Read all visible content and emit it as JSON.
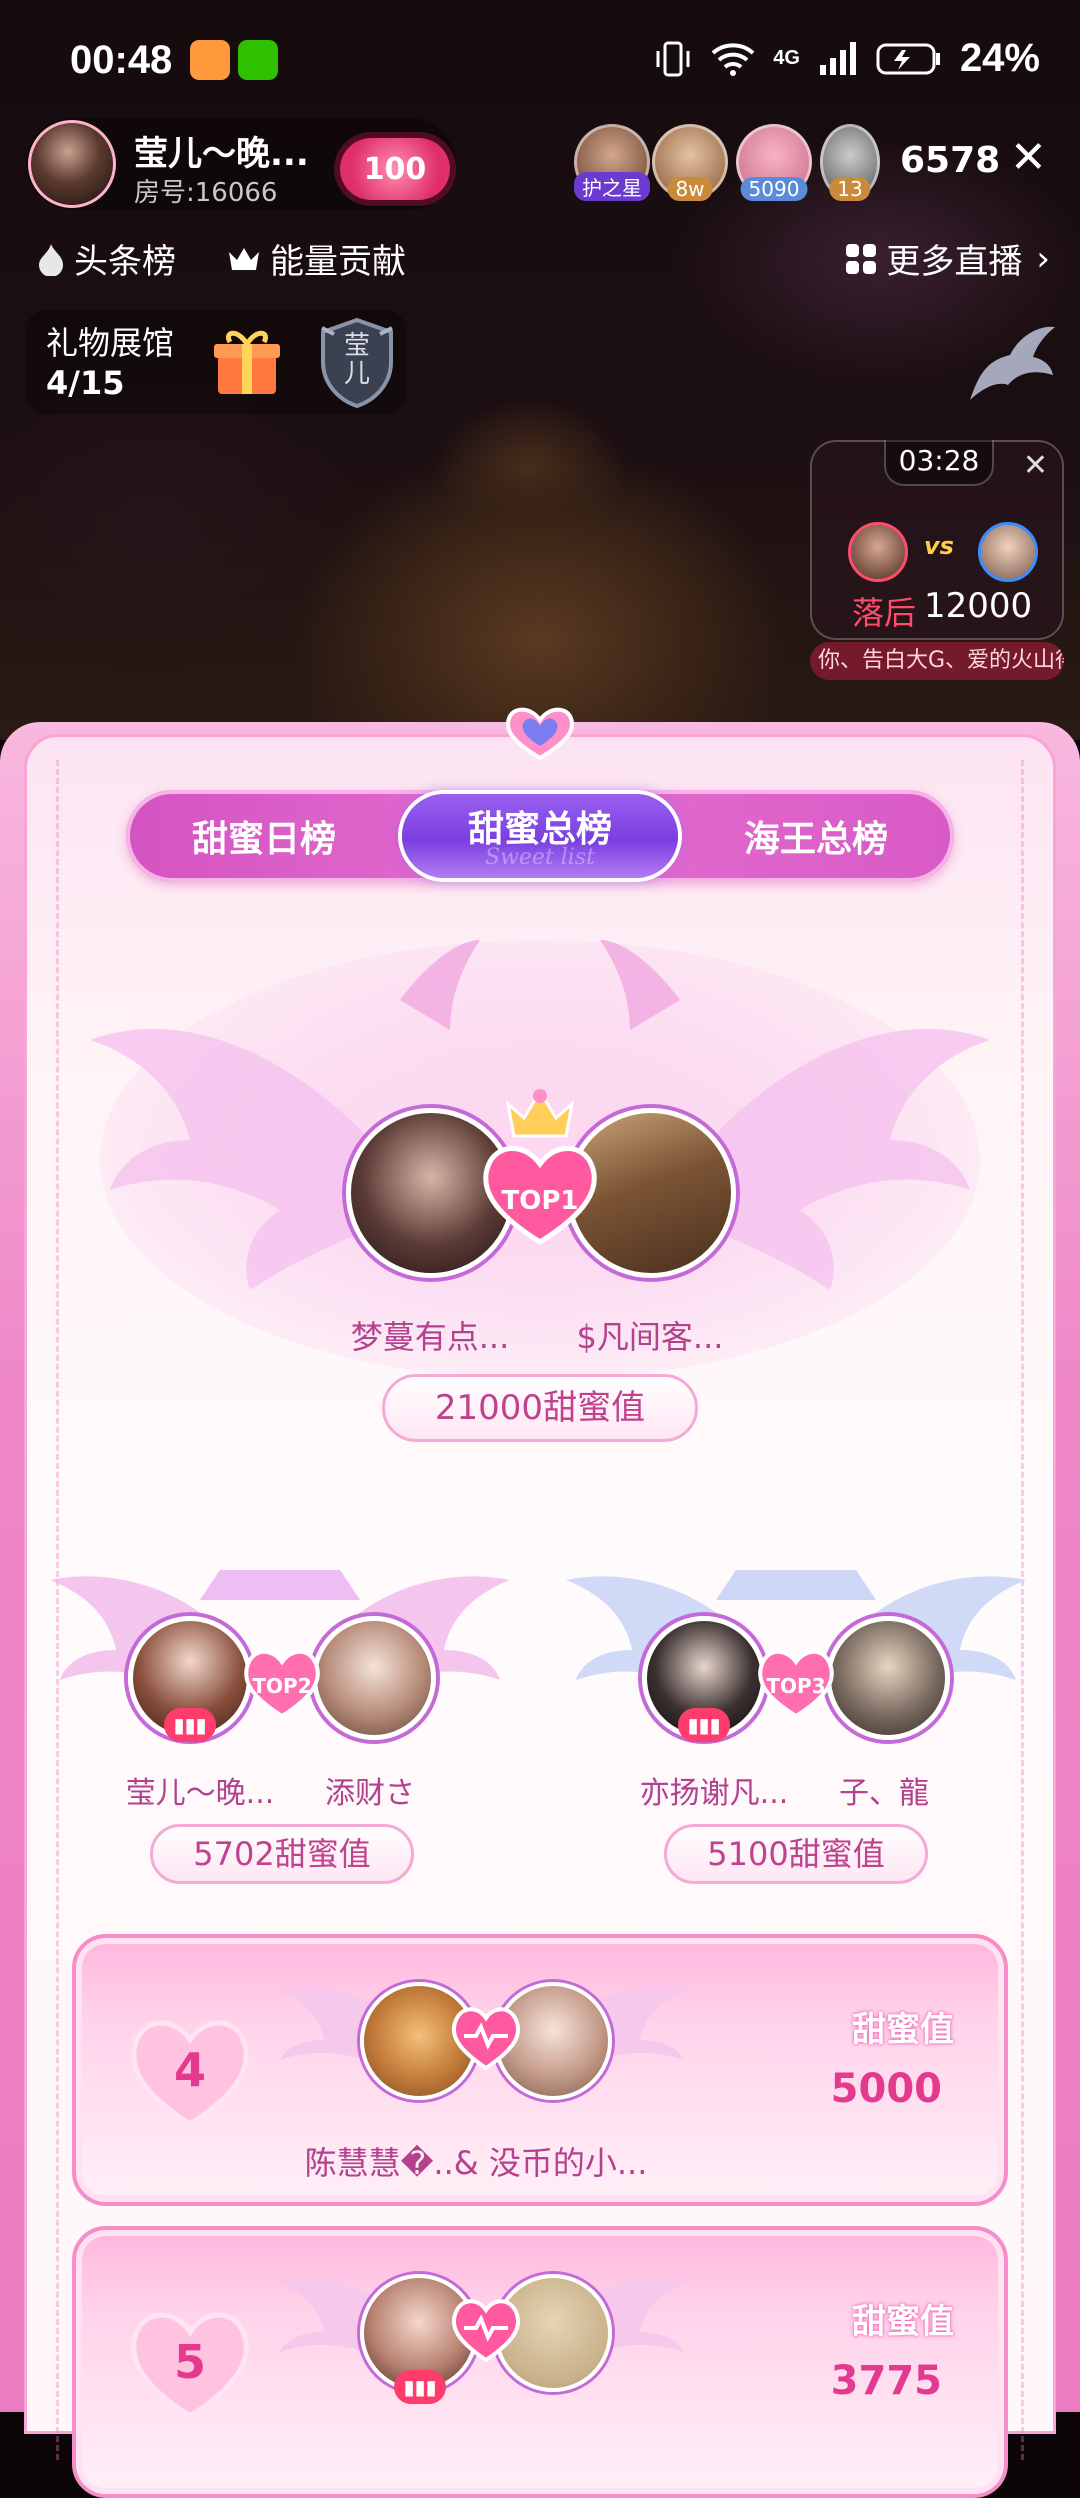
{
  "status_bar": {
    "time": "00:48",
    "network": "4G",
    "battery": "24%"
  },
  "host": {
    "name": "莹儿～晚...",
    "room": "房号:16066",
    "fans_level": "100"
  },
  "viewers": {
    "badges": [
      "护之星",
      "8w",
      "5090",
      "13"
    ],
    "count": "6578"
  },
  "nav": {
    "headline_rank": "头条榜",
    "energy": "能量贡献",
    "more_live": "更多直播"
  },
  "gift_hall": {
    "title": "礼物展馆",
    "count": "4/15",
    "shield_text": "莹儿"
  },
  "pk": {
    "timer": "03:28",
    "vs": "vs",
    "status": "落后",
    "score": "12000",
    "ticker": "你、告白大G、爱的火山得"
  },
  "ranking": {
    "tabs": [
      {
        "label": "甜蜜日榜"
      },
      {
        "label": "甜蜜总榜",
        "subtitle": "Sweet list",
        "active": true
      },
      {
        "label": "海王总榜"
      }
    ],
    "top1": {
      "tag": "TOP1",
      "name_left": "梦蔓有点...",
      "name_right": "$凡间客...",
      "score": "21000甜蜜值"
    },
    "top2": {
      "tag": "TOP2",
      "name_left": "莹儿～晚...",
      "name_right": "添财さ",
      "score": "5702甜蜜值"
    },
    "top3": {
      "tag": "TOP3",
      "name_left": "亦扬谢凡...",
      "name_right": "子、龍",
      "score": "5100甜蜜值"
    },
    "list": [
      {
        "rank": "4",
        "names": "陈慧慧�..& 没币的小...",
        "label": "甜蜜值",
        "score": "5000"
      },
      {
        "rank": "5",
        "names": "",
        "label": "甜蜜值",
        "score": "3775"
      }
    ]
  },
  "colors": {
    "accent_pink": "#e3398f",
    "tab_active": "#8a4de8",
    "sheet_border": "#f48dc8"
  }
}
